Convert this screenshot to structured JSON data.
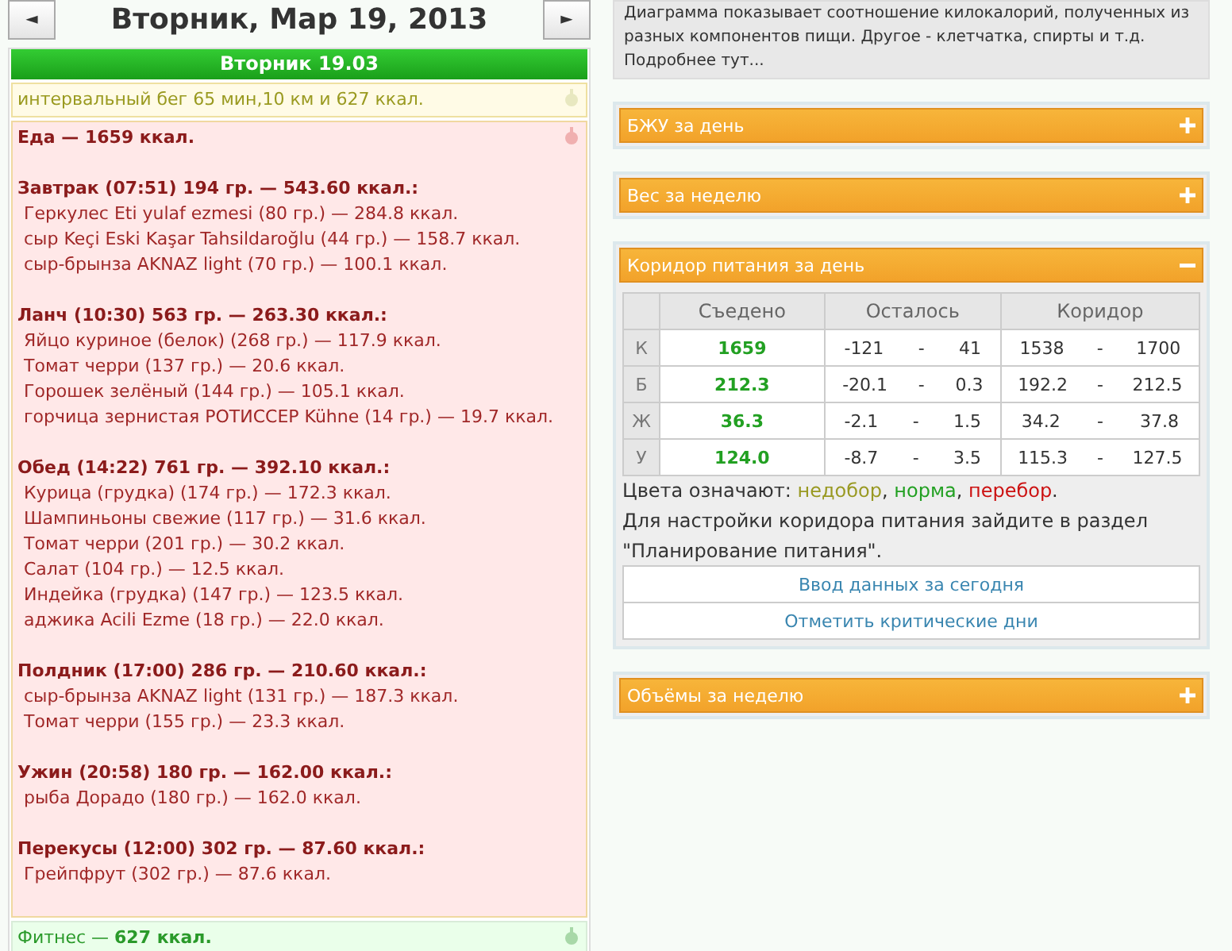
{
  "day_nav": {
    "prev": "◄",
    "title": "Вторник, Мар 19, 2013",
    "next": "►"
  },
  "day": {
    "header": "Вторник 19.03",
    "sections": [
      {
        "kind": "activity",
        "text": "интервальный бег 65 мин,10 км и 627 ккал."
      },
      {
        "kind": "food",
        "title": "Еда — 1659 ккал.",
        "meals": [
          {
            "title": "Завтрак (07:51) 194 гр. — 543.60 ккал.:",
            "items": [
              "Геркулес Eti yulaf ezmesi (80 гр.) — 284.8 ккал.",
              "сыр Keçi Eski Kaşar Tahsildaroğlu (44 гр.) — 158.7 ккал.",
              "сыр-брынза AKNAZ light (70 гр.) — 100.1 ккал."
            ]
          },
          {
            "title": "Ланч (10:30) 563 гр. — 263.30 ккал.:",
            "items": [
              "Яйцо куриное (белок) (268 гр.) — 117.9 ккал.",
              "Томат черри (137 гр.) — 20.6 ккал.",
              "Горошек зелёный (144 гр.) — 105.1 ккал.",
              "горчица зернистая РОТИССЕР Kühne (14 гр.) — 19.7 ккал."
            ]
          },
          {
            "title": "Обед (14:22) 761 гр. — 392.10 ккал.:",
            "items": [
              "Курица (грудка) (174 гр.) — 172.3 ккал.",
              "Шампиньоны свежие (117 гр.) — 31.6 ккал.",
              "Томат черри (201 гр.) — 30.2 ккал.",
              "Салат (104 гр.) — 12.5 ккал.",
              "Индейка (грудка) (147 гр.) — 123.5 ккал.",
              "аджика Acili Ezme (18 гр.) — 22.0 ккал."
            ]
          },
          {
            "title": "Полдник (17:00) 286 гр. — 210.60 ккал.:",
            "items": [
              "сыр-брынза AKNAZ light (131 гр.) — 187.3 ккал.",
              "Томат черри (155 гр.) — 23.3 ккал."
            ]
          },
          {
            "title": "Ужин (20:58) 180 гр. — 162.00 ккал.:",
            "items": [
              "рыба Дорадо (180 гр.) — 162.0 ккал."
            ]
          },
          {
            "title": "Перекусы (12:00) 302 гр. — 87.60 ккал.:",
            "items": [
              "Грейпфрут (302 гр.) — 87.6 ккал."
            ]
          }
        ]
      },
      {
        "kind": "fitness",
        "text": "Фитнес — **627 ккал.**"
      }
    ]
  },
  "info": {
    "text": "Диаграмма показывает соотношение килокалорий, полученных из разных компонентов пищи. Другое - клетчатка, спирты и т.д. Подробнее тут..."
  },
  "panels": [
    {
      "title": "БЖУ за день",
      "expanded": false
    },
    {
      "title": "Вес за неделю",
      "expanded": false
    },
    {
      "title": "Коридор питания за день",
      "expanded": true,
      "table": {
        "columns": [
          "Съедено",
          "Осталось",
          "Коридор"
        ],
        "rows": [
          {
            "label": "К",
            "eaten": "1659",
            "left_from": "-121",
            "left_to": "41",
            "range_from": "1538",
            "range_to": "1700"
          },
          {
            "label": "Б",
            "eaten": "212.3",
            "left_from": "-20.1",
            "left_to": "0.3",
            "range_from": "192.2",
            "range_to": "212.5"
          },
          {
            "label": "Ж",
            "eaten": "36.3",
            "left_from": "-2.1",
            "left_to": "1.5",
            "range_from": "34.2",
            "range_to": "37.8"
          },
          {
            "label": "У",
            "eaten": "124.0",
            "left_from": "-8.7",
            "left_to": "3.5",
            "range_from": "115.3",
            "range_to": "127.5"
          }
        ],
        "separator": "-"
      },
      "legend": {
        "label": "Цвета означают:",
        "separator": ",",
        "items": [
          {
            "text": "недобор",
            "color": "#999922"
          },
          {
            "text": "норма",
            "color": "#22a022"
          },
          {
            "text": "перебор",
            "color": "#cc1111"
          }
        ],
        "end": "."
      },
      "note": "Для настройки коридора питания зайдите в раздел \"Планирование питания\".",
      "buttons": [
        "Ввод данных за сегодня",
        "Отметить критические дни"
      ]
    },
    {
      "title": "Объёмы за неделю",
      "expanded": false
    }
  ]
}
